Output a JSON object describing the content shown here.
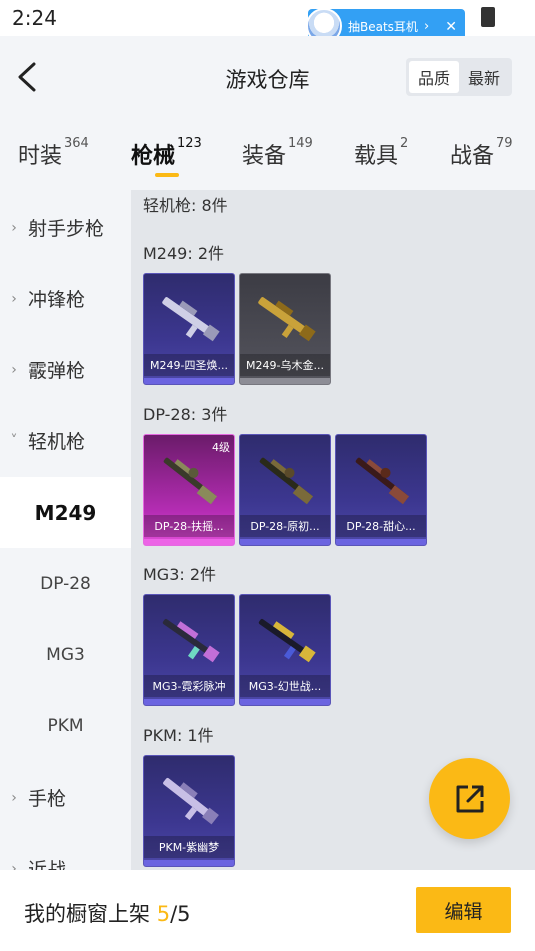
{
  "status": {
    "time": "2:24"
  },
  "promo": {
    "text": "抽Beats耳机",
    "chevron": "›",
    "close": "✕"
  },
  "header": {
    "title": "游戏仓库",
    "sort_options": [
      "品质",
      "最新"
    ],
    "active_sort": "品质"
  },
  "tabs": [
    {
      "label": "时装",
      "count": "364"
    },
    {
      "label": "枪械",
      "count": "123"
    },
    {
      "label": "装备",
      "count": "149"
    },
    {
      "label": "载具",
      "count": "2"
    },
    {
      "label": "战备",
      "count": "79"
    }
  ],
  "sidebar": {
    "categories": [
      {
        "label": "射手步枪",
        "chevron": "›"
      },
      {
        "label": "冲锋枪",
        "chevron": "›"
      },
      {
        "label": "霰弹枪",
        "chevron": "›"
      },
      {
        "label": "轻机枪",
        "chevron": "˅"
      },
      {
        "label": "手枪",
        "chevron": "›"
      },
      {
        "label": "近战",
        "chevron": "›"
      }
    ],
    "subitems": [
      "M249",
      "DP-28",
      "MG3",
      "PKM"
    ],
    "active_sub": "M249"
  },
  "content": {
    "section_title": "轻机枪: 8件",
    "groups": [
      {
        "title": "M249: 2件",
        "items": [
          {
            "name": "M249-四圣焕...",
            "rarity": "purple",
            "weapon_color": "#cfcfe6"
          },
          {
            "name": "M249-乌木金...",
            "rarity": "gray",
            "weapon_color": "#c9a23a"
          }
        ]
      },
      {
        "title": "DP-28: 3件",
        "items": [
          {
            "name": "DP-28-扶摇...",
            "rarity": "pink",
            "badge": "4级",
            "weapon_color": "#8a8a5a"
          },
          {
            "name": "DP-28-原初...",
            "rarity": "purple",
            "weapon_color": "#7a6a3a"
          },
          {
            "name": "DP-28-甜心...",
            "rarity": "purple",
            "weapon_color": "#8a4a3a"
          }
        ]
      },
      {
        "title": "MG3: 2件",
        "items": [
          {
            "name": "MG3-霓彩脉冲",
            "rarity": "purple",
            "weapon_color": "#c26fd8"
          },
          {
            "name": "MG3-幻世战...",
            "rarity": "purple",
            "weapon_color": "#d8b63a"
          }
        ]
      },
      {
        "title": "PKM: 1件",
        "items": [
          {
            "name": "PKM-紫幽梦",
            "rarity": "purple",
            "weapon_color": "#c8bfe6"
          }
        ]
      }
    ]
  },
  "showcase": {
    "label": "我的橱窗上架 ",
    "current": "5",
    "separator": "/",
    "total": "5"
  },
  "edit_label": "编辑",
  "colors": {
    "accent": "#fbb915",
    "purple_card": "#3c3790",
    "pink_card": "#b52db4"
  }
}
